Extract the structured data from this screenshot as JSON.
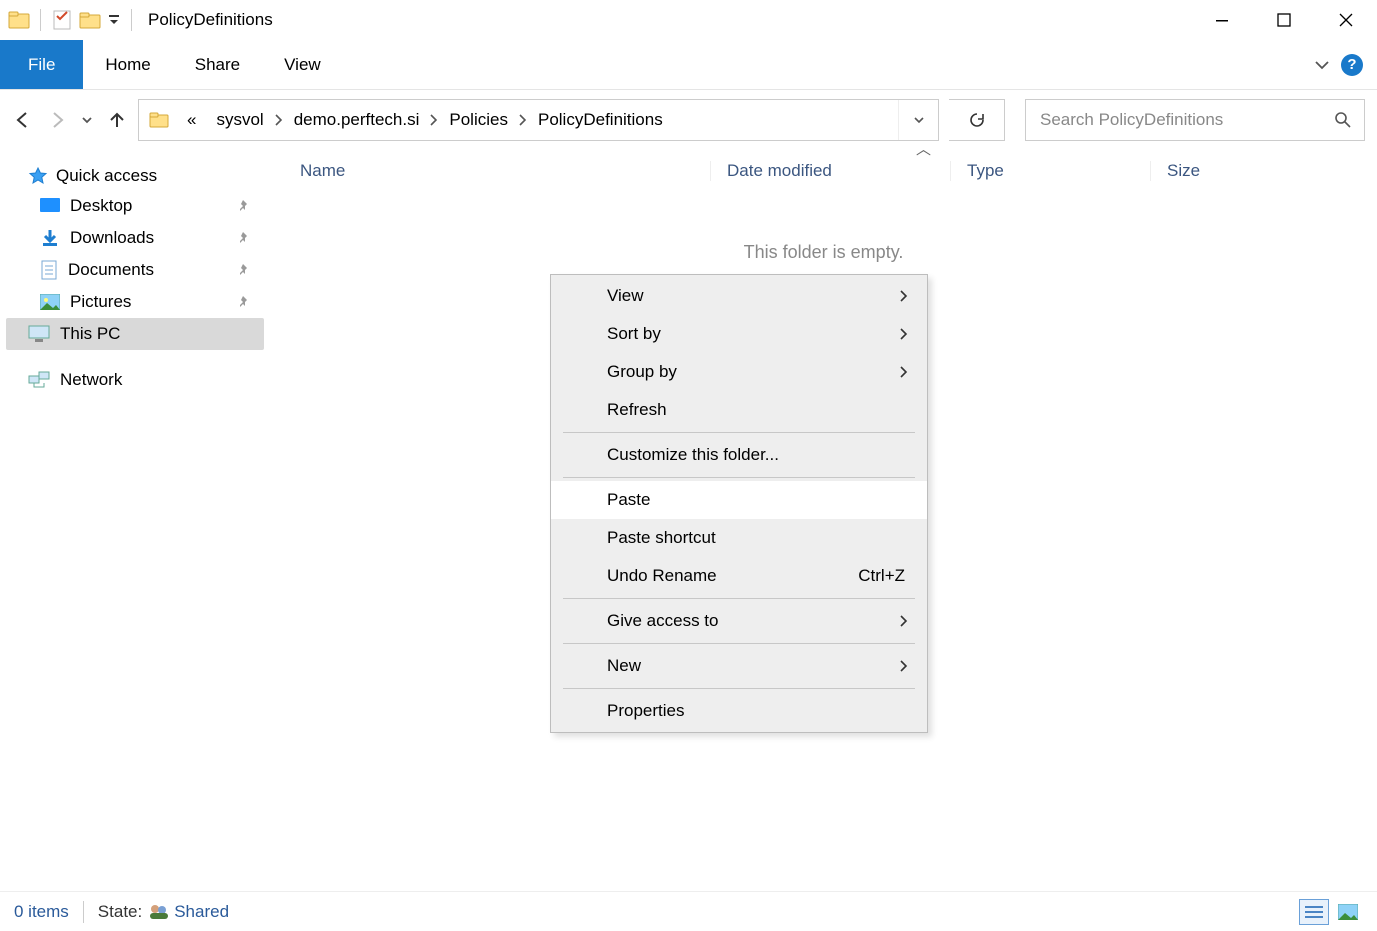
{
  "window": {
    "title": "PolicyDefinitions"
  },
  "ribbon": {
    "file": "File",
    "home": "Home",
    "share": "Share",
    "view": "View"
  },
  "breadcrumb": {
    "prefix": "«",
    "parts": [
      "sysvol",
      "demo.perftech.si",
      "Policies",
      "PolicyDefinitions"
    ]
  },
  "search": {
    "placeholder": "Search PolicyDefinitions"
  },
  "tree": {
    "quick_access": "Quick access",
    "items": [
      {
        "label": "Desktop",
        "pinned": true
      },
      {
        "label": "Downloads",
        "pinned": true
      },
      {
        "label": "Documents",
        "pinned": true
      },
      {
        "label": "Pictures",
        "pinned": true
      }
    ],
    "this_pc": "This PC",
    "network": "Network"
  },
  "columns": {
    "name": "Name",
    "date": "Date modified",
    "type": "Type",
    "size": "Size"
  },
  "content": {
    "empty": "This folder is empty."
  },
  "context_menu": {
    "view": "View",
    "sort_by": "Sort by",
    "group_by": "Group by",
    "refresh": "Refresh",
    "customize": "Customize this folder...",
    "paste": "Paste",
    "paste_shortcut": "Paste shortcut",
    "undo_rename": "Undo Rename",
    "undo_shortcut": "Ctrl+Z",
    "give_access": "Give access to",
    "new": "New",
    "properties": "Properties"
  },
  "status": {
    "items": "0 items",
    "state_label": "State:",
    "state_value": "Shared"
  }
}
